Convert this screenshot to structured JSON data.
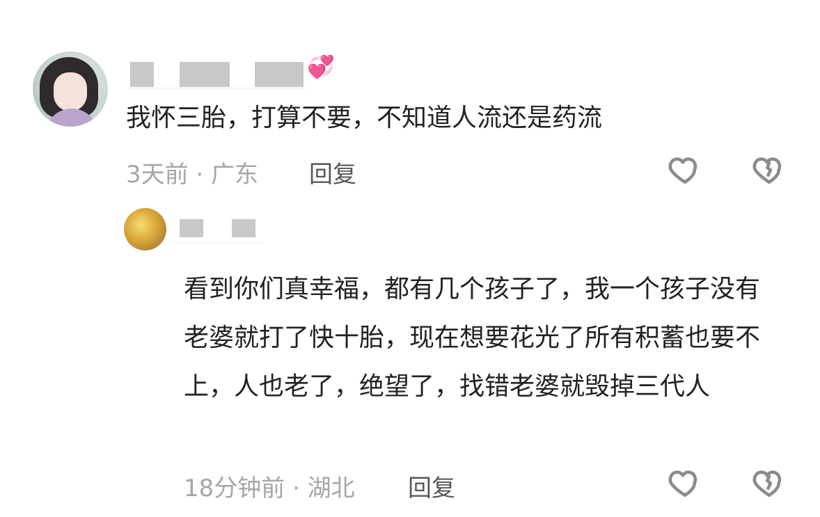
{
  "main_comment": {
    "text": "我怀三胎，打算不要，不知道人流还是药流",
    "emoji": "💞",
    "meta": "3天前 · 广东",
    "reply_label": "回复",
    "like_icon": "heart-icon",
    "dislike_icon": "broken-heart-icon"
  },
  "reply_comment": {
    "text": "看到你们真幸福，都有几个孩子了，我一个孩子没有老婆就打了快十胎，现在想要花光了所有积蓄也要不上，人也老了，绝望了，找错老婆就毁掉三代人",
    "meta": "18分钟前 · 湖北",
    "reply_label": "回复",
    "like_icon": "heart-icon",
    "dislike_icon": "broken-heart-icon"
  },
  "colors": {
    "text": "#222222",
    "meta": "#a6a6a6",
    "reply": "#575757",
    "emoji": "#ef4f9c"
  }
}
